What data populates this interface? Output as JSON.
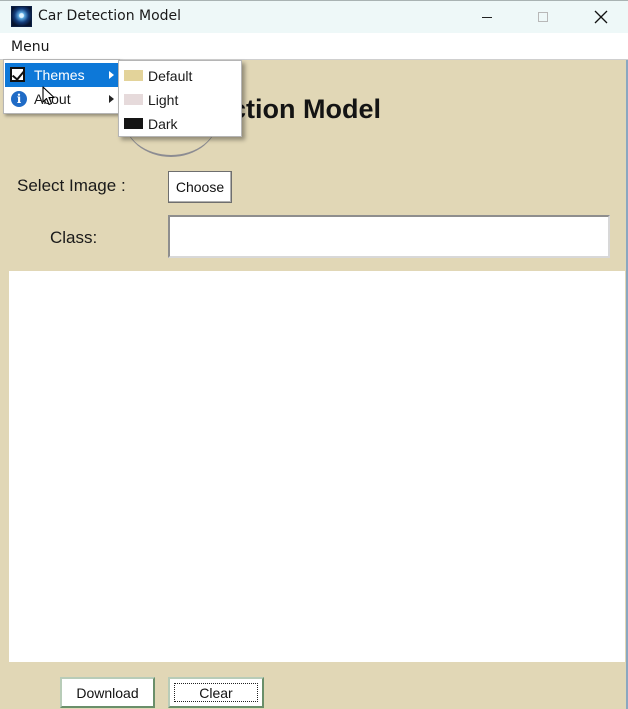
{
  "window": {
    "title": "Car Detection Model"
  },
  "menubar": {
    "menu_label": "Menu"
  },
  "dropdown": {
    "items": [
      {
        "label": "Themes",
        "icon": "checkbox-icon",
        "has_submenu": true,
        "selected": true
      },
      {
        "label": "About",
        "icon": "info-icon",
        "has_submenu": true,
        "selected": false
      }
    ],
    "info_glyph": "i"
  },
  "submenu": {
    "items": [
      {
        "label": "Default",
        "swatch_color": "#e3d39a"
      },
      {
        "label": "Light",
        "swatch_color": "#e6dadb"
      },
      {
        "label": "Dark",
        "swatch_color": "#151515"
      }
    ]
  },
  "main": {
    "heading": "Car Detection Model",
    "select_label": "Select Image :",
    "choose_label": "Choose",
    "class_label": "Class:",
    "class_value": "",
    "download_label": "Download",
    "clear_label": "Clear"
  },
  "colors": {
    "background": "#e1d7b6",
    "menu_highlight": "#0d78d8",
    "panel": "#ffffff"
  }
}
